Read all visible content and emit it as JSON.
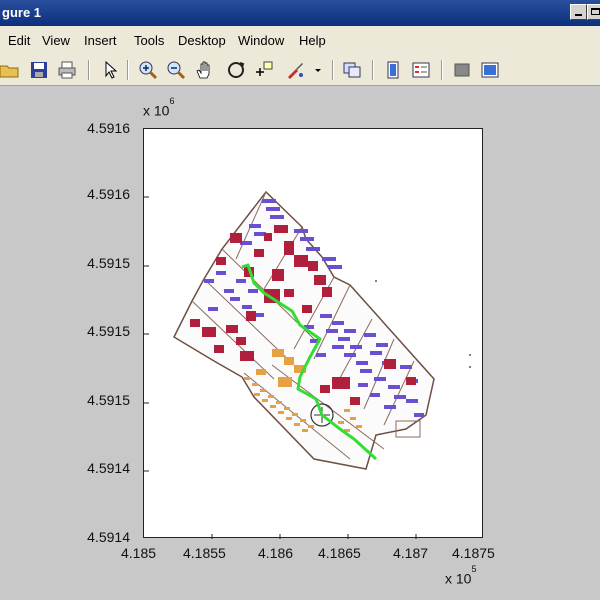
{
  "window": {
    "title": "gure 1"
  },
  "menu": [
    "Edit",
    "View",
    "Insert",
    "Tools",
    "Desktop",
    "Window",
    "Help"
  ],
  "toolbar_icons": [
    "open-folder-icon",
    "save-icon",
    "print-icon",
    "pointer-icon",
    "zoom-in-icon",
    "zoom-out-icon",
    "pan-hand-icon",
    "rotate-3d-icon",
    "data-cursor-icon",
    "brush-icon",
    "dropdown-arrow-icon",
    "link-plot-icon",
    "colorbar-icon",
    "legend-icon",
    "hide-plot-tools-icon",
    "show-plot-tools-icon"
  ],
  "axes": {
    "y_ticks": [
      "4.5916",
      "4.5916",
      "4.5915",
      "4.5915",
      "4.5915",
      "4.5914",
      "4.5914"
    ],
    "x_ticks": [
      "4.185",
      "4.1855",
      "4.186",
      "4.1865",
      "4.187",
      "4.1875"
    ],
    "y_exponent": {
      "base": "x 10",
      "power": "6"
    },
    "x_exponent": {
      "base": "x 10",
      "power": "5"
    }
  },
  "colors": {
    "building_red": "#b0203c",
    "building_purple": "#6a4fd0",
    "building_orange": "#e8a040",
    "route_green": "#33dd33",
    "outline": "#7a5a4a"
  }
}
